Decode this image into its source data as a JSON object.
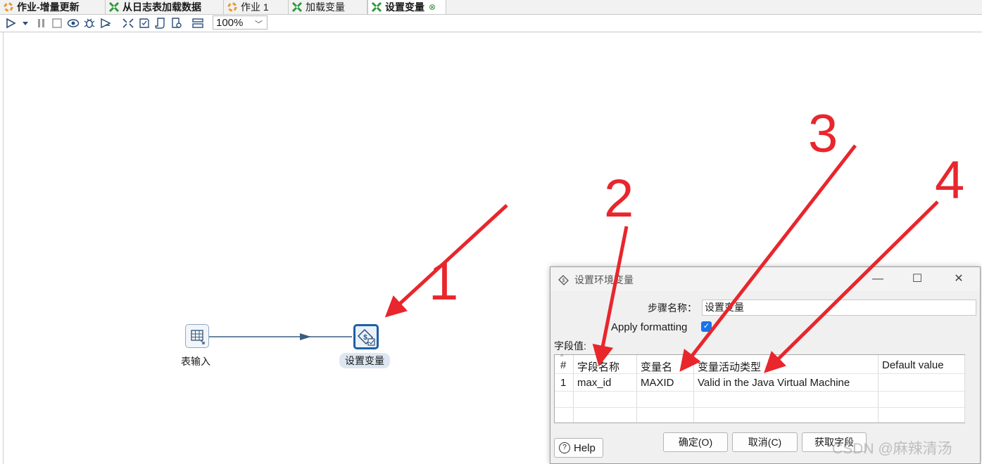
{
  "tabs": [
    {
      "label": "作业-增量更新",
      "kind": "job",
      "bold": true
    },
    {
      "label": "从日志表加载数据",
      "kind": "transform",
      "bold": true
    },
    {
      "label": "作业 1",
      "kind": "job",
      "bold": false
    },
    {
      "label": "加载变量",
      "kind": "transform",
      "bold": false
    },
    {
      "label": "设置变量",
      "kind": "transform",
      "bold": true,
      "active": true
    }
  ],
  "toolbar": {
    "zoom": "100%"
  },
  "canvas": {
    "steps": [
      {
        "label": "表输入",
        "icon": "table-input-icon"
      },
      {
        "label": "设置变量",
        "icon": "set-variable-icon"
      }
    ]
  },
  "dialog": {
    "title": "设置环境变量",
    "step_name_label": "步骤名称：",
    "step_name_value": "设置变量",
    "apply_formatting_label": "Apply formatting",
    "apply_formatting_checked": true,
    "fields_label": "字段值:",
    "columns": [
      "#",
      "字段名称",
      "变量名",
      "变量活动类型",
      "Default value"
    ],
    "rows": [
      {
        "num": "1",
        "field": "max_id",
        "variable": "MAXID",
        "scope": "Valid in the Java Virtual Machine",
        "default": ""
      }
    ],
    "buttons": {
      "ok": "确定(O)",
      "cancel": "取消(C)",
      "get_fields": "获取字段",
      "help": "Help"
    }
  },
  "annotations": {
    "numbers": [
      "1",
      "2",
      "3",
      "4"
    ],
    "arrow_color": "#e8262c"
  },
  "watermark": "CSDN @麻辣清汤"
}
